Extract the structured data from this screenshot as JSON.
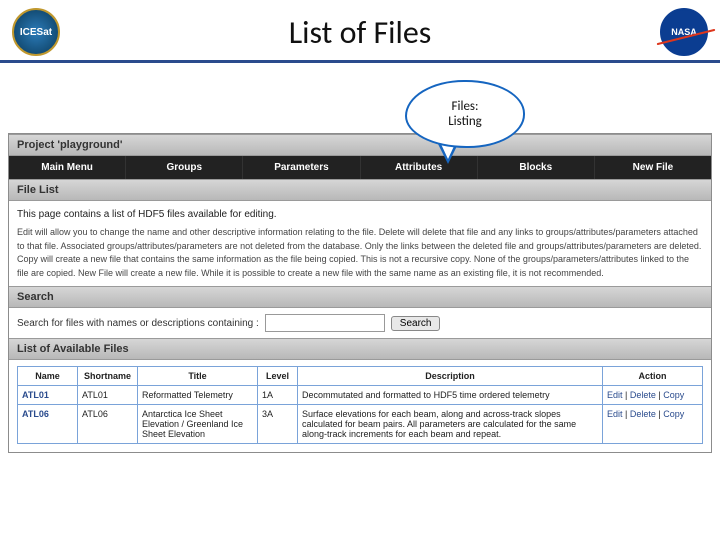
{
  "slide": {
    "title": "List of Files",
    "left_logo_text": "ICESat",
    "right_logo_text": "NASA"
  },
  "bubble": {
    "line1": "Files:",
    "line2": "Listing"
  },
  "project_header": "Project 'playground'",
  "nav": {
    "main": "Main Menu",
    "groups": "Groups",
    "parameters": "Parameters",
    "attributes": "Attributes",
    "blocks": "Blocks",
    "newfile": "New File"
  },
  "file_list_header": "File List",
  "help": {
    "lead": "This page contains a list of HDF5 files available for editing.",
    "body": "Edit will allow you to change the name and other descriptive information relating to the file. Delete will delete that file and any links to groups/attributes/parameters attached to that file. Associated groups/attributes/parameters are not deleted from the database. Only the links between the deleted file and groups/attributes/parameters are deleted. Copy will create a new file that contains the same information as the file being copied. This is not a recursive copy. None of the groups/parameters/attributes linked to the file are copied. New File will create a new file. While it is possible to create a new file with the same name as an existing file, it is not recommended."
  },
  "search": {
    "label": "Search for files with names or descriptions containing :",
    "button": "Search",
    "value": ""
  },
  "search_header": "Search",
  "list_header": "List of Available Files",
  "columns": {
    "name": "Name",
    "shortname": "Shortname",
    "title": "Title",
    "level": "Level",
    "description": "Description",
    "action": "Action"
  },
  "actions": {
    "edit": "Edit",
    "delete": "Delete",
    "copy": "Copy",
    "sep": " | "
  },
  "rows": [
    {
      "name": "ATL01",
      "shortname": "ATL01",
      "title": "Reformatted Telemetry",
      "level": "1A",
      "description": "Decommutated and formatted to HDF5 time ordered telemetry"
    },
    {
      "name": "ATL06",
      "shortname": "ATL06",
      "title": "Antarctica Ice Sheet Elevation / Greenland Ice Sheet Elevation",
      "level": "3A",
      "description": "Surface elevations for each beam, along and across-track slopes calculated for beam pairs. All parameters are calculated for the same along-track increments for each beam and repeat."
    }
  ]
}
